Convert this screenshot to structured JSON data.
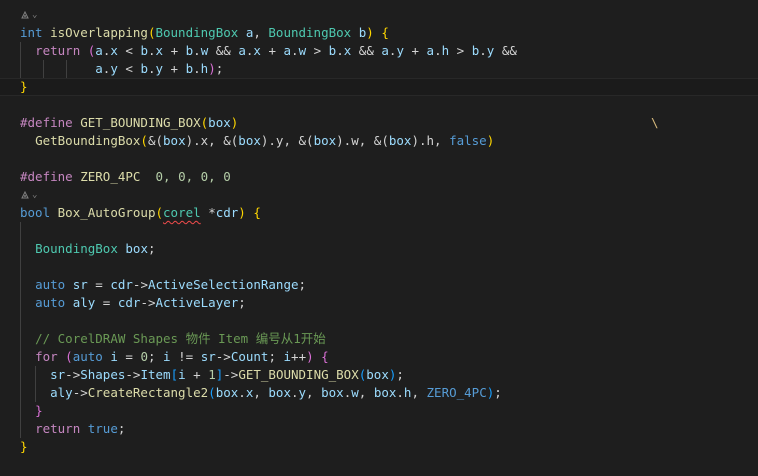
{
  "codelens": {
    "label": ""
  },
  "lines": {
    "l1": [
      "int",
      " ",
      "isOverlapping",
      "(",
      "BoundingBox",
      " ",
      "a",
      ", ",
      "BoundingBox",
      " ",
      "b",
      ")",
      " ",
      "{"
    ],
    "l2": [
      "return",
      " ",
      "(",
      "a",
      ".",
      "x",
      " < ",
      "b",
      ".",
      "x",
      " + ",
      "b",
      ".",
      "w",
      " && ",
      "a",
      ".",
      "x",
      " + ",
      "a",
      ".",
      "w",
      " > ",
      "b",
      ".",
      "x",
      " && ",
      "a",
      ".",
      "y",
      " + ",
      "a",
      ".",
      "h",
      " > ",
      "b",
      ".",
      "y",
      " &&"
    ],
    "l3": [
      "a",
      ".",
      "y",
      " < ",
      "b",
      ".",
      "y",
      " + ",
      "b",
      ".",
      "h",
      ")",
      ";"
    ],
    "l4": [
      "}"
    ],
    "l6": [
      "#define",
      " ",
      "GET_BOUNDING_BOX",
      "(",
      "box",
      ")",
      "\\"
    ],
    "l7": [
      "GetBoundingBox",
      "(",
      "&(",
      "box",
      ").x, ",
      "&(",
      "box",
      ").y, ",
      "&(",
      "box",
      ").w, ",
      "&(",
      "box",
      ").h, ",
      "false",
      ")"
    ],
    "l9": [
      "#define",
      " ",
      "ZERO_4PC",
      "  ",
      "0, 0, 0, 0"
    ],
    "l10": [
      "bool",
      " ",
      "Box_AutoGroup",
      "(",
      "corel",
      " ",
      "*",
      "cdr",
      ")",
      " ",
      "{"
    ],
    "l12": [
      "BoundingBox",
      " ",
      "box",
      ";"
    ],
    "l14": [
      "auto",
      " ",
      "sr",
      " = ",
      "cdr",
      "->",
      "ActiveSelectionRange",
      ";"
    ],
    "l15": [
      "auto",
      " ",
      "aly",
      " = ",
      "cdr",
      "->",
      "ActiveLayer",
      ";"
    ],
    "l17": [
      "// CorelDRAW Shapes 物件 Item 编号从1开始"
    ],
    "l18": [
      "for",
      " ",
      "(",
      "auto",
      " ",
      "i",
      " = ",
      "0",
      "; ",
      "i",
      " != ",
      "sr",
      "->",
      "Count",
      "; ",
      "i",
      "++",
      ")",
      " ",
      "{"
    ],
    "l19": [
      "sr",
      "->",
      "Shapes",
      "->",
      "Item",
      "[",
      "i",
      " + ",
      "1",
      "]",
      "->",
      "GET_BOUNDING_BOX",
      "(",
      "box",
      ")",
      ";"
    ],
    "l20": [
      "aly",
      "->",
      "CreateRectangle2",
      "(",
      "box",
      ".",
      "x",
      ", ",
      "box",
      ".",
      "y",
      ", ",
      "box",
      ".",
      "w",
      ", ",
      "box",
      ".",
      "h",
      ", ",
      "ZERO_4PC",
      ")",
      ";"
    ],
    "l21": [
      "}"
    ],
    "l22": [
      "return",
      " ",
      "true",
      ";"
    ],
    "l23": [
      "}"
    ]
  }
}
